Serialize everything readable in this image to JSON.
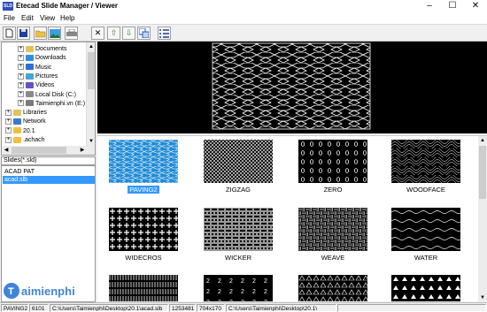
{
  "window": {
    "title": "Etecad Slide Manager / Viewer",
    "icon_text": "SLD"
  },
  "menu": [
    "File",
    "Edit",
    "View",
    "Help"
  ],
  "tree": [
    {
      "label": "Documents",
      "color": "#e3c25a"
    },
    {
      "label": "Downloads",
      "color": "#2f8ee0"
    },
    {
      "label": "Music",
      "color": "#2f6fd0"
    },
    {
      "label": "Pictures",
      "color": "#4aa0d8"
    },
    {
      "label": "Videos",
      "color": "#6a4fc8"
    },
    {
      "label": "Local Disk (C:)",
      "color": "#8a8a8a"
    },
    {
      "label": "Taimienphi.vn  (E:)",
      "color": "#7a7a7a"
    },
    {
      "label": "Libraries",
      "color": "#e3c25a"
    },
    {
      "label": "Network",
      "color": "#3a7ad0"
    },
    {
      "label": "20.1",
      "color": "#f0c040"
    },
    {
      "label": ".achach",
      "color": "#f0c040"
    }
  ],
  "slides_filter": "Slides(*.sld)",
  "slide_files": [
    {
      "label": "ACAD PAT",
      "selected": false
    },
    {
      "label": "acad.slb",
      "selected": true
    }
  ],
  "thumbnails": [
    {
      "label": "PAVING2",
      "pattern": "paving",
      "selected": true
    },
    {
      "label": "ZIGZAG",
      "pattern": "zigzag",
      "selected": false
    },
    {
      "label": "ZERO",
      "pattern": "zero",
      "selected": false
    },
    {
      "label": "WOODFACE",
      "pattern": "woodface",
      "selected": false
    },
    {
      "label": "WIDECROS",
      "pattern": "widecros",
      "selected": false
    },
    {
      "label": "WICKER",
      "pattern": "wicker",
      "selected": false
    },
    {
      "label": "WEAVE",
      "pattern": "weave",
      "selected": false
    },
    {
      "label": "WATER",
      "pattern": "water",
      "selected": false
    },
    {
      "label": "",
      "pattern": "vlines",
      "selected": false
    },
    {
      "label": "",
      "pattern": "numbers",
      "selected": false
    },
    {
      "label": "",
      "pattern": "triangles",
      "selected": false
    },
    {
      "label": "",
      "pattern": "triangles2",
      "selected": false
    }
  ],
  "status": {
    "name": "PAVING2",
    "size": "6101",
    "path": "C:\\Users\\Taimienphi\\Desktop\\20.1\\acad.slb",
    "lib_size": "1253481",
    "dims": "704x170",
    "folder": "C:\\Users\\Taimienphi\\Desktop\\20.1\\"
  },
  "watermark": "Taimienphi",
  "colors": {
    "selection": "#3399ff",
    "thumb_selected": "#1f8bd6"
  }
}
